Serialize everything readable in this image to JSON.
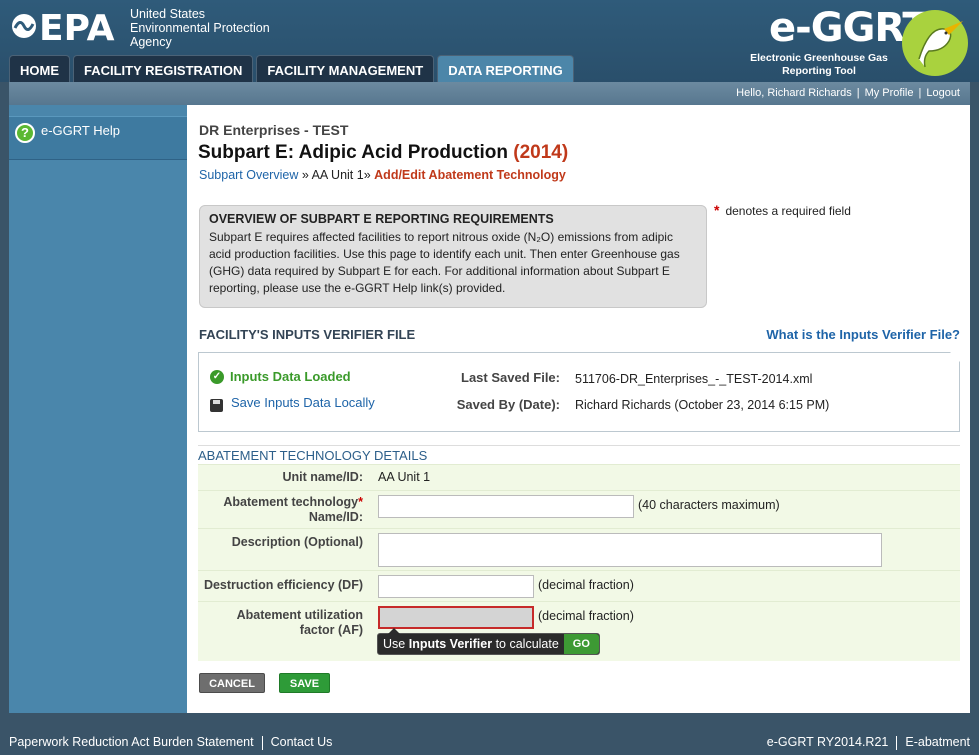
{
  "header": {
    "epa_mark": "EPA",
    "epa_lines": [
      "United States",
      "Environmental Protection",
      "Agency"
    ],
    "egg_title": "e-GGRT",
    "egg_sub_1": "Electronic Greenhouse Gas",
    "egg_sub_2": "Reporting Tool",
    "tabs": [
      "HOME",
      "FACILITY REGISTRATION",
      "FACILITY MANAGEMENT",
      "DATA REPORTING"
    ]
  },
  "userbar": {
    "greeting": "Hello, Richard Richards",
    "profile": "My Profile",
    "logout": "Logout",
    "sep": "|"
  },
  "sidebar": {
    "help_icon": "?",
    "help_label": "e-GGRT Help"
  },
  "main": {
    "org": "DR Enterprises - TEST",
    "title": "Subpart E: Adipic Acid Production",
    "year": "(2014)",
    "breadcrumb": {
      "overview": "Subpart Overview",
      "sep1": "»",
      "unit": "AA Unit 1",
      "sep2": "»",
      "current": "Add/Edit Abatement Technology"
    },
    "overview": {
      "heading": "OVERVIEW OF SUBPART E REPORTING REQUIREMENTS",
      "text": "Subpart E requires affected facilities to report nitrous oxide (N₂O) emissions from adipic acid production facilities. Use this page to identify each unit. Then enter Greenhouse gas (GHG) data required by Subpart E for each. For additional information about Subpart E reporting, please use the e-GGRT Help link(s) provided."
    },
    "required_note": {
      "asterisk": "*",
      "text": "denotes a required field"
    },
    "inputs_verifier": {
      "heading": "FACILITY'S INPUTS VERIFIER FILE",
      "link": "What is the Inputs Verifier File?",
      "loaded_check": "✓",
      "loaded": "Inputs Data Loaded",
      "save_locally": "Save Inputs Data Locally",
      "last_saved_label": "Last Saved File:",
      "last_saved_value": "511706-DR_Enterprises_-_TEST-2014.xml",
      "saved_by_label": "Saved By (Date):",
      "saved_by_value": "Richard Richards (October 23, 2014 6:15 PM)"
    },
    "abatement": {
      "heading": "ABATEMENT TECHNOLOGY DETAILS",
      "unit_label": "Unit name/ID:",
      "unit_value": "AA Unit 1",
      "tech_label_1": "Abatement technology",
      "tech_label_2": "Name/ID:",
      "tech_asterisk": "*",
      "tech_hint": "(40 characters maximum)",
      "tech_value": "",
      "desc_label": "Description (Optional)",
      "desc_value": "",
      "df_label": "Destruction efficiency (DF)",
      "df_hint": "(decimal fraction)",
      "df_value": "",
      "af_label_1": "Abatement utilization",
      "af_label_2": "factor (AF)",
      "af_hint": "(decimal fraction)",
      "af_value": "",
      "tooltip_pre": "Use",
      "tooltip_bold": "Inputs Verifier",
      "tooltip_post": "to calculate",
      "go": "GO"
    },
    "buttons": {
      "cancel": "CANCEL",
      "save": "SAVE"
    }
  },
  "footer": {
    "paperwork": "Paperwork Reduction Act Burden Statement",
    "contact": "Contact Us",
    "version": "e-GGRT RY2014.R21",
    "module": "E-abatment"
  }
}
